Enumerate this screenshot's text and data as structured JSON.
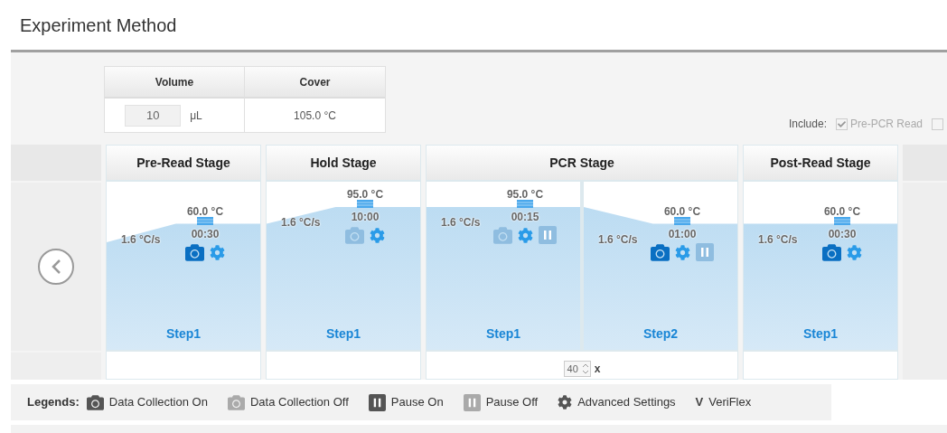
{
  "header": {
    "title": "Experiment Method"
  },
  "settings": {
    "columns": [
      {
        "heading": "Volume"
      },
      {
        "heading": "Cover"
      }
    ],
    "volume": {
      "value": "10",
      "unit": "μL"
    },
    "cover": "105.0 °C"
  },
  "include": {
    "label": "Include:",
    "options": [
      {
        "label": "Pre-PCR Read",
        "checked": true,
        "disabled": true
      },
      {
        "checked": false,
        "disabled": true
      }
    ]
  },
  "stages": [
    {
      "name": "Pre-Read Stage",
      "kind": "hold",
      "steps": [
        {
          "temperature": "60.0 °C",
          "time": "00:30",
          "rate": "1.6 °C/s",
          "kind": "low",
          "collect": true,
          "label": "Step1"
        }
      ]
    },
    {
      "name": "Hold Stage",
      "kind": "hold",
      "steps": [
        {
          "temperature": "95.0 °C",
          "time": "10:00",
          "rate": "1.6 °C/s",
          "kind": "high",
          "collect": false,
          "label": "Step1"
        }
      ]
    },
    {
      "name": "PCR Stage",
      "kind": "cycling",
      "cycles": "40",
      "cycles_suffix": "x",
      "steps": [
        {
          "temperature": "95.0 °C",
          "time": "00:15",
          "rate": "1.6 °C/s",
          "kind": "high",
          "collect": false,
          "pause": false,
          "label": "Step1"
        },
        {
          "temperature": "60.0 °C",
          "time": "01:00",
          "rate": "1.6 °C/s",
          "kind": "low",
          "collect": true,
          "pause": false,
          "label": "Step2"
        }
      ]
    },
    {
      "name": "Post-Read Stage",
      "kind": "hold",
      "steps": [
        {
          "temperature": "60.0 °C",
          "time": "00:30",
          "rate": "1.6 °C/s",
          "kind": "low",
          "collect": true,
          "label": "Step1"
        }
      ]
    }
  ],
  "legend": {
    "title": "Legends:",
    "items": [
      {
        "kind": "collect_on",
        "label": "Data Collection On"
      },
      {
        "kind": "collect_off",
        "label": "Data Collection Off"
      },
      {
        "kind": "pause_on",
        "label": "Pause On"
      },
      {
        "kind": "pause_off",
        "label": "Pause Off"
      },
      {
        "kind": "advanced",
        "label": "Advanced Settings"
      },
      {
        "kind": "veriflex",
        "symbol": "V",
        "label": "VeriFlex"
      }
    ]
  }
}
